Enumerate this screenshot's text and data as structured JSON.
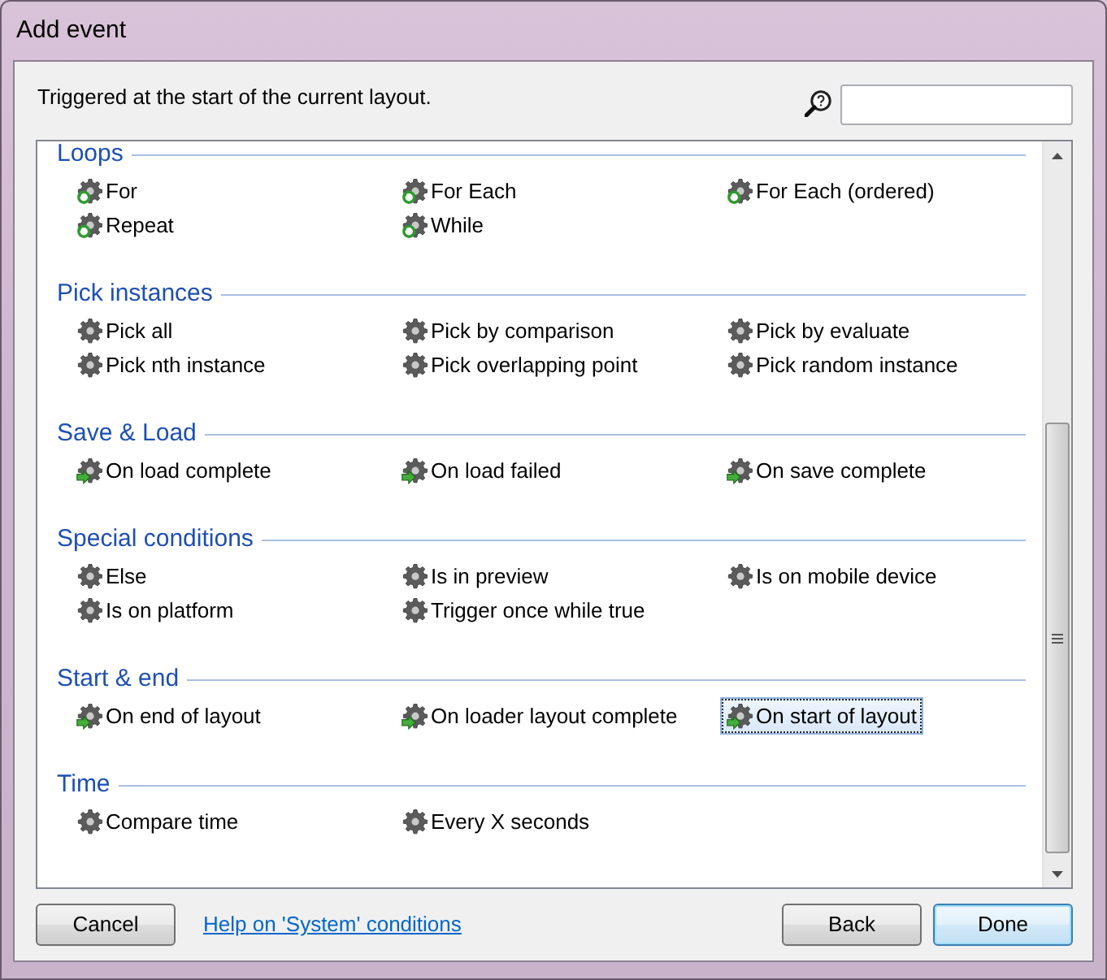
{
  "window": {
    "title": "Add event"
  },
  "description": "Triggered at the start of the current layout.",
  "sections": [
    {
      "title": "Loops",
      "items": [
        {
          "label": "For",
          "kind": "loop",
          "selected": false
        },
        {
          "label": "For Each",
          "kind": "loop",
          "selected": false
        },
        {
          "label": "For Each (ordered)",
          "kind": "loop",
          "selected": false
        },
        {
          "label": "Repeat",
          "kind": "loop",
          "selected": false
        },
        {
          "label": "While",
          "kind": "loop",
          "selected": false
        }
      ]
    },
    {
      "title": "Pick instances",
      "items": [
        {
          "label": "Pick all",
          "kind": "condition",
          "selected": false
        },
        {
          "label": "Pick by comparison",
          "kind": "condition",
          "selected": false
        },
        {
          "label": "Pick by evaluate",
          "kind": "condition",
          "selected": false
        },
        {
          "label": "Pick nth instance",
          "kind": "condition",
          "selected": false
        },
        {
          "label": "Pick overlapping point",
          "kind": "condition",
          "selected": false
        },
        {
          "label": "Pick random instance",
          "kind": "condition",
          "selected": false
        }
      ]
    },
    {
      "title": "Save & Load",
      "items": [
        {
          "label": "On load complete",
          "kind": "trigger",
          "selected": false
        },
        {
          "label": "On load failed",
          "kind": "trigger",
          "selected": false
        },
        {
          "label": "On save complete",
          "kind": "trigger",
          "selected": false
        }
      ]
    },
    {
      "title": "Special conditions",
      "items": [
        {
          "label": "Else",
          "kind": "condition",
          "selected": false
        },
        {
          "label": "Is in preview",
          "kind": "condition",
          "selected": false
        },
        {
          "label": "Is on mobile device",
          "kind": "condition",
          "selected": false
        },
        {
          "label": "Is on platform",
          "kind": "condition",
          "selected": false
        },
        {
          "label": "Trigger once while true",
          "kind": "condition",
          "selected": false
        }
      ]
    },
    {
      "title": "Start & end",
      "items": [
        {
          "label": "On end of layout",
          "kind": "trigger",
          "selected": false
        },
        {
          "label": "On loader layout complete",
          "kind": "trigger",
          "selected": false
        },
        {
          "label": "On start of layout",
          "kind": "trigger",
          "selected": true
        }
      ]
    },
    {
      "title": "Time",
      "items": [
        {
          "label": "Compare time",
          "kind": "condition",
          "selected": false
        },
        {
          "label": "Every X seconds",
          "kind": "condition",
          "selected": false
        }
      ]
    }
  ],
  "footer": {
    "left_buttons": [
      {
        "label": "Cancel",
        "default": false
      }
    ],
    "help_link": "Help on 'System' conditions",
    "right_buttons": [
      {
        "label": "Back",
        "default": false
      },
      {
        "label": "Done",
        "default": true
      }
    ]
  }
}
